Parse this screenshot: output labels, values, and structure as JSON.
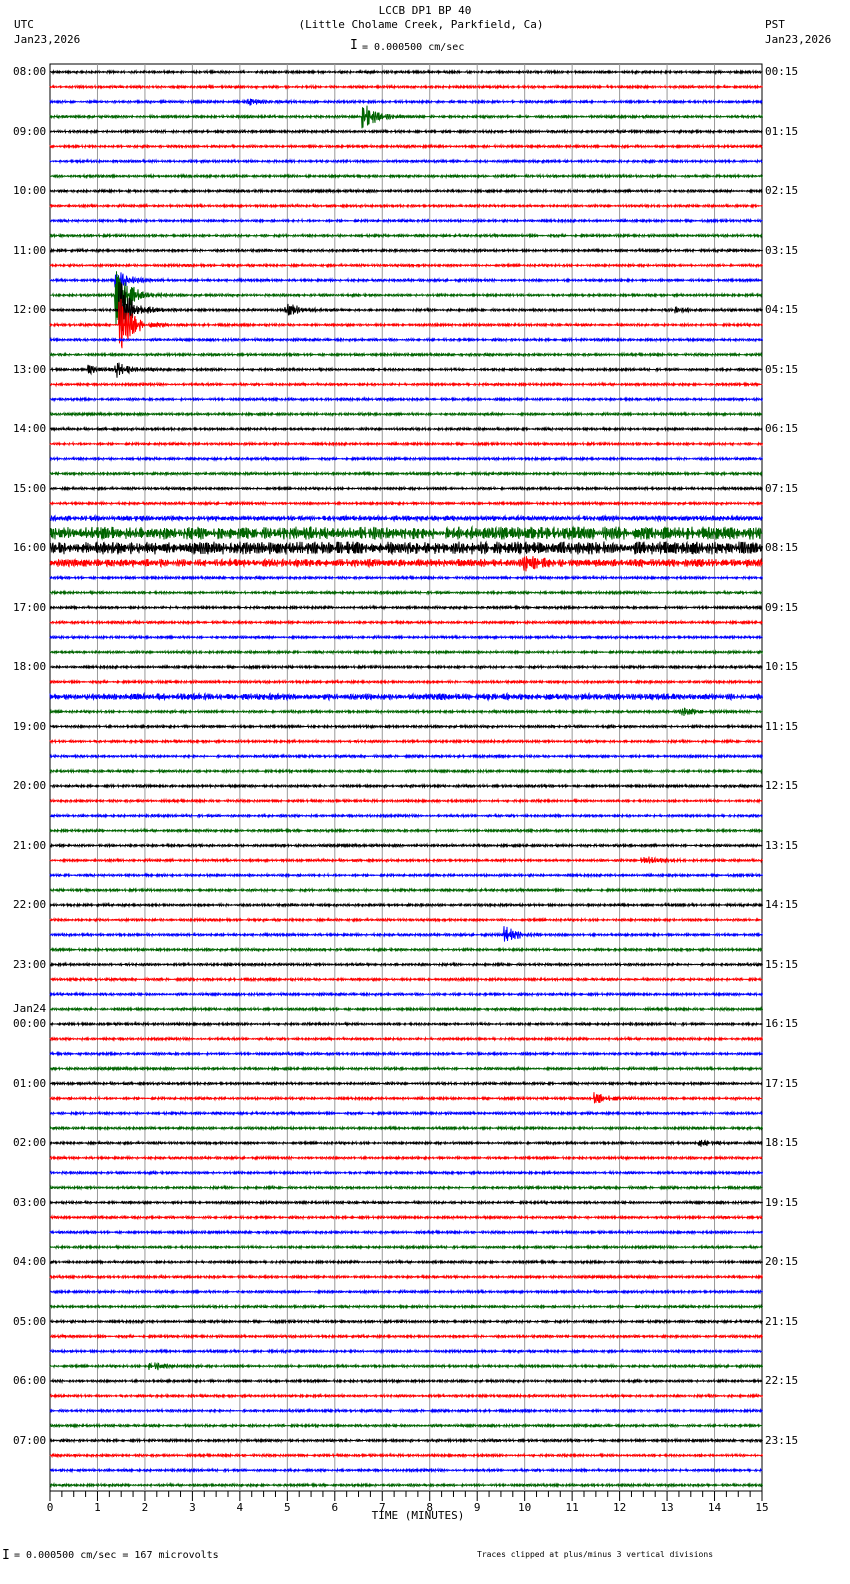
{
  "header": {
    "title": "LCCB DP1 BP 40",
    "subtitle": "(Little Cholame Creek, Parkfield, Ca)",
    "left_tz": "UTC",
    "left_date": "Jan23,2026",
    "right_tz": "PST",
    "right_date": "Jan23,2026",
    "scale": "= 0.000500 cm/sec"
  },
  "footer": {
    "scale": "= 0.000500 cm/sec =     167 microvolts",
    "clip_note": "Traces clipped at plus/minus 3 vertical divisions"
  },
  "chart_data": {
    "type": "line",
    "title": "LCCB DP1 BP 40",
    "xlabel": "TIME (MINUTES)",
    "xlim": [
      0,
      15
    ],
    "x_ticks": [
      "0",
      "1",
      "2",
      "3",
      "4",
      "5",
      "6",
      "7",
      "8",
      "9",
      "10",
      "11",
      "12",
      "13",
      "14",
      "15"
    ],
    "trace_count": 96,
    "trace_colors": [
      "#000000",
      "#ff0000",
      "#0000ff",
      "#006400"
    ],
    "left_labels": [
      "08:00",
      "09:00",
      "10:00",
      "11:00",
      "12:00",
      "13:00",
      "14:00",
      "15:00",
      "16:00",
      "17:00",
      "18:00",
      "19:00",
      "20:00",
      "21:00",
      "22:00",
      "23:00",
      "00:00",
      "01:00",
      "02:00",
      "03:00",
      "04:00",
      "05:00",
      "06:00",
      "07:00"
    ],
    "date_change_label": "Jan24",
    "right_labels": [
      "00:15",
      "01:15",
      "02:15",
      "03:15",
      "04:15",
      "05:15",
      "06:15",
      "07:15",
      "08:15",
      "09:15",
      "10:15",
      "11:15",
      "12:15",
      "13:15",
      "14:15",
      "15:15",
      "16:15",
      "17:15",
      "18:15",
      "19:15",
      "20:15",
      "21:15",
      "22:15",
      "23:15"
    ],
    "events": [
      {
        "trace": 2,
        "minute": 4.2,
        "amp": 3
      },
      {
        "trace": 3,
        "minute": 6.6,
        "amp": 14
      },
      {
        "trace": 14,
        "minute": 1.4,
        "amp": 10
      },
      {
        "trace": 15,
        "minute": 1.4,
        "amp": 30
      },
      {
        "trace": 16,
        "minute": 1.5,
        "amp": 30
      },
      {
        "trace": 16,
        "minute": 5.0,
        "amp": 8
      },
      {
        "trace": 16,
        "minute": 13.0,
        "amp": 5
      },
      {
        "trace": 17,
        "minute": 1.5,
        "amp": 25
      },
      {
        "trace": 20,
        "minute": 0.8,
        "amp": 4
      },
      {
        "trace": 20,
        "minute": 1.4,
        "amp": 7
      },
      {
        "trace": 33,
        "minute": 10.0,
        "amp": 6
      },
      {
        "trace": 43,
        "minute": 13.3,
        "amp": 4
      },
      {
        "trace": 53,
        "minute": 12.5,
        "amp": 5
      },
      {
        "trace": 58,
        "minute": 9.6,
        "amp": 8
      },
      {
        "trace": 69,
        "minute": 11.5,
        "amp": 5
      },
      {
        "trace": 72,
        "minute": 13.7,
        "amp": 3
      },
      {
        "trace": 87,
        "minute": 2.1,
        "amp": 6
      }
    ],
    "noisy_traces": {
      "30": 2,
      "31": 5,
      "32": 5,
      "33": 3,
      "42": 2.5
    }
  }
}
